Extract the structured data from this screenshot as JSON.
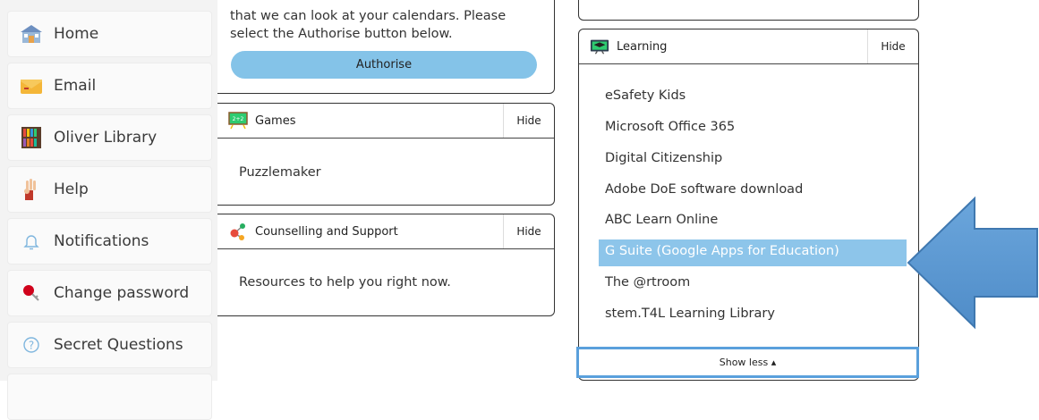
{
  "sidebar": {
    "items": [
      {
        "label": "Home",
        "icon": "school-icon"
      },
      {
        "label": "Email",
        "icon": "envelope-icon"
      },
      {
        "label": "Oliver Library",
        "icon": "bookshelf-icon"
      },
      {
        "label": "Help",
        "icon": "raised-hand-icon"
      },
      {
        "label": "Notifications",
        "icon": "bell-icon"
      },
      {
        "label": "Change password",
        "icon": "key-icon"
      },
      {
        "label": "Secret Questions",
        "icon": "question-circle-icon"
      }
    ]
  },
  "calendar": {
    "text_line1": "that we can look at your calendars. Please",
    "text_line2": "select the Authorise button below.",
    "authorise_label": "Authorise"
  },
  "games": {
    "title": "Games",
    "hide_label": "Hide",
    "links": [
      "Puzzlemaker"
    ]
  },
  "counselling": {
    "title": "Counselling and Support",
    "hide_label": "Hide",
    "links": [
      "Resources to help you right now."
    ]
  },
  "learning": {
    "title": "Learning",
    "hide_label": "Hide",
    "links": [
      "eSafety Kids",
      "Microsoft Office 365",
      "Digital Citizenship",
      "Adobe DoE software download",
      "ABC Learn Online",
      "G Suite (Google Apps for Education)",
      "The @rtroom",
      "stem.T4L Learning Library"
    ],
    "selected_index": 5,
    "show_less_label": "Show less ▴"
  },
  "colors": {
    "accent": "#84c3e8",
    "arrow": "#5b9bd5",
    "selected": "#8dc5ea"
  }
}
